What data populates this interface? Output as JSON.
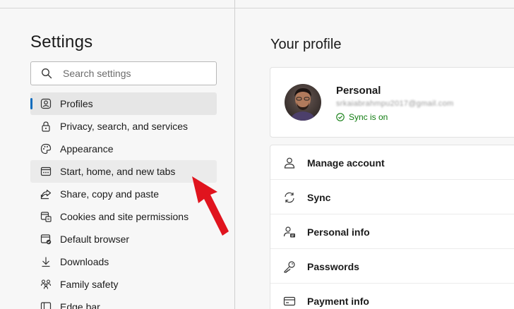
{
  "sidebar": {
    "title": "Settings",
    "search_placeholder": "Search settings",
    "items": [
      {
        "label": "Profiles",
        "icon": "profile-icon"
      },
      {
        "label": "Privacy, search, and services",
        "icon": "lock-icon"
      },
      {
        "label": "Appearance",
        "icon": "palette-icon"
      },
      {
        "label": "Start, home, and new tabs",
        "icon": "tabs-icon"
      },
      {
        "label": "Share, copy and paste",
        "icon": "share-icon"
      },
      {
        "label": "Cookies and site permissions",
        "icon": "cookie-icon"
      },
      {
        "label": "Default browser",
        "icon": "browser-icon"
      },
      {
        "label": "Downloads",
        "icon": "download-icon"
      },
      {
        "label": "Family safety",
        "icon": "family-icon"
      },
      {
        "label": "Edge bar",
        "icon": "edge-bar-icon"
      }
    ]
  },
  "main": {
    "title": "Your profile",
    "profile": {
      "name": "Personal",
      "email": "srkaiabrahmpu2017@gmail.com",
      "sync_status": "Sync is on"
    },
    "options": [
      {
        "label": "Manage account",
        "icon": "person-icon"
      },
      {
        "label": "Sync",
        "icon": "sync-icon"
      },
      {
        "label": "Personal info",
        "icon": "personal-info-icon"
      },
      {
        "label": "Passwords",
        "icon": "key-icon"
      },
      {
        "label": "Payment info",
        "icon": "card-icon"
      }
    ]
  },
  "colors": {
    "accent": "#0f6cbd",
    "sync_green": "#107c10",
    "annotation_arrow": "#e0141e"
  }
}
